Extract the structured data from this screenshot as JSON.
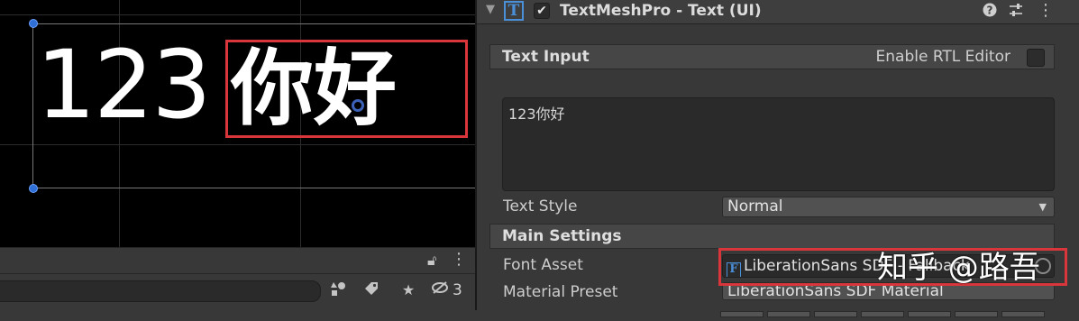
{
  "scene": {
    "number_text": "123",
    "chinese_text": "你好"
  },
  "scene_toolbar": {
    "lock_icon": "lock-icon",
    "menu_icon": "kebab-menu-icon",
    "search_placeholder": "",
    "icons": [
      "scene-visibility-icon",
      "tag-icon",
      "star-icon",
      "hidden-eye-icon"
    ],
    "hidden_count": "3"
  },
  "inspector": {
    "component": {
      "title": "TextMeshPro - Text (UI)",
      "enabled": true,
      "icons": [
        "help-icon",
        "presets-icon",
        "more-icon"
      ]
    },
    "text_input": {
      "section_title": "Text Input",
      "rtl_label": "Enable RTL Editor",
      "rtl_checked": false,
      "value": "123你好"
    },
    "text_style": {
      "label": "Text Style",
      "value": "Normal"
    },
    "main_settings": {
      "section_title": "Main Settings",
      "font_asset_label": "Font Asset",
      "font_asset_value": "LiberationSans SDF - Fallback",
      "material_preset_label": "Material Preset",
      "material_preset_value": "LiberationSans SDF Material"
    },
    "watermark": "知乎 @路吾"
  },
  "colors": {
    "highlight": "#d9363b",
    "accent": "#4a90d9",
    "handle": "#2f6fd6"
  }
}
